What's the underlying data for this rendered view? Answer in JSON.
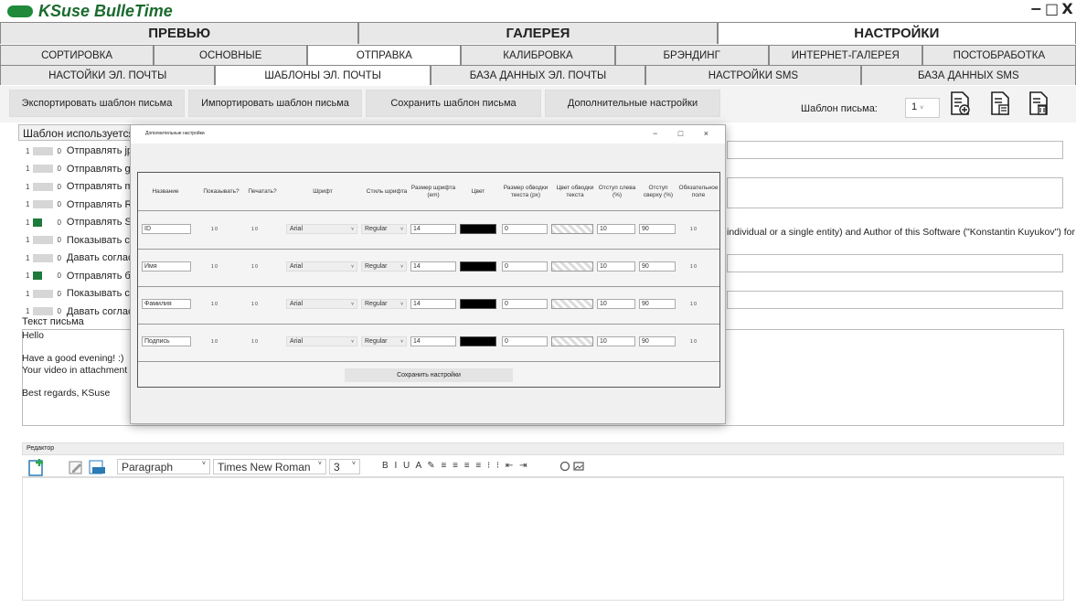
{
  "app": {
    "title": "KSuse BulleTime",
    "logo_color": "#1e8a3a",
    "window_buttons": [
      "−",
      "□",
      "X"
    ]
  },
  "tabs_main": [
    {
      "label": "ПРЕВЬЮ",
      "selected": false
    },
    {
      "label": "ГАЛЕРЕЯ",
      "selected": false
    },
    {
      "label": "НАСТРОЙКИ",
      "selected": true
    }
  ],
  "tabs_sub": [
    {
      "label": "СОРТИРОВКА",
      "selected": false
    },
    {
      "label": "ОСНОВНЫЕ",
      "selected": false
    },
    {
      "label": "ОТПРАВКА",
      "selected": true
    },
    {
      "label": "КАЛИБРОВКА",
      "selected": false
    },
    {
      "label": "БРЭНДИНГ",
      "selected": false
    },
    {
      "label": "ИНТЕРНЕТ-ГАЛЕРЕЯ",
      "selected": false
    },
    {
      "label": "ПОСТОБРАБОТКА",
      "selected": false
    }
  ],
  "tabs_third": [
    {
      "label": "НАСТОЙКИ ЭЛ. ПОЧТЫ",
      "selected": false
    },
    {
      "label": "ШАБЛОНЫ ЭЛ. ПОЧТЫ",
      "selected": true
    },
    {
      "label": "БАЗА ДАННЫХ ЭЛ. ПОЧТЫ",
      "selected": false
    },
    {
      "label": "НАСТРОЙКИ SMS",
      "selected": false
    },
    {
      "label": "БАЗА ДАННЫХ SMS",
      "selected": false
    }
  ],
  "toolbar": {
    "export": "Экспортировать шаблон письма",
    "import": "Импортировать шаблон письма",
    "save": "Сохранить шаблон письма",
    "advanced": "Дополнительные настройки",
    "template_label": "Шаблон письма:",
    "template_value": "1"
  },
  "left_list": {
    "header": "Шаблон используется",
    "items": [
      {
        "label": "Отправлять jpg",
        "on": false
      },
      {
        "label": "Отправлять gif",
        "on": false
      },
      {
        "label": "Отправлять mp4",
        "on": false
      },
      {
        "label": "Отправлять RB A",
        "on": false
      },
      {
        "label": "Отправлять SM A",
        "on": true
      },
      {
        "label": "Показывать согл",
        "on": false
      },
      {
        "label": "Давать согласие",
        "on": false
      },
      {
        "label": "Отправлять без с",
        "on": true
      },
      {
        "label": "Показывать согл",
        "on": false
      },
      {
        "label": "Давать согласие",
        "on": false
      }
    ],
    "n1": "1",
    "n0": "0"
  },
  "agreement_text": "individual or a single entity) and Author of this Software (\"Konstantin Kuyukov\") for",
  "letter": {
    "label": "Текст письма",
    "text": "Hello\n\nHave a good evening! :)\nYour video in attachment\n\nBest regards, KSuse"
  },
  "editor": {
    "tab_label": "Редактор",
    "paragraph": "Paragraph",
    "font": "Times New Roman",
    "size": "3",
    "format_glyphs": "B I U A ✎ ≡ ≡ ≡ ≡ ⁝ ⁝ ⇤ ⇥"
  },
  "dialog": {
    "title": "Дополнительные настройки",
    "controls": "− □ ×",
    "headers": [
      "Название",
      "Показывать?",
      "Печатать?",
      "Шрифт",
      "Стиль шрифта",
      "Размер шрифта (em)",
      "Цвет",
      "Размер обводки текста (px)",
      "Цвет обводки текста",
      "Отступ слева (%)",
      "Отступ сверху (%)",
      "Обязательное поле"
    ],
    "rows": [
      {
        "name": "ID",
        "show": "1 0",
        "print": "1 0",
        "font": "Arial",
        "style": "Regular",
        "size": "14",
        "stroke": "0",
        "left": "10",
        "top": "90",
        "req": "1 0"
      },
      {
        "name": "Имя",
        "show": "1 0",
        "print": "1 0",
        "font": "Arial",
        "style": "Regular",
        "size": "14",
        "stroke": "0",
        "left": "10",
        "top": "90",
        "req": "1 0"
      },
      {
        "name": "Фамилия",
        "show": "1 0",
        "print": "1 0",
        "font": "Arial",
        "style": "Regular",
        "size": "14",
        "stroke": "0",
        "left": "10",
        "top": "90",
        "req": "1 0"
      },
      {
        "name": "Подпись",
        "show": "1 0",
        "print": "1 0",
        "font": "Arial",
        "style": "Regular",
        "size": "14",
        "stroke": "0",
        "left": "10",
        "top": "90",
        "req": "1 0"
      }
    ],
    "save": "Сохранить настройки"
  }
}
